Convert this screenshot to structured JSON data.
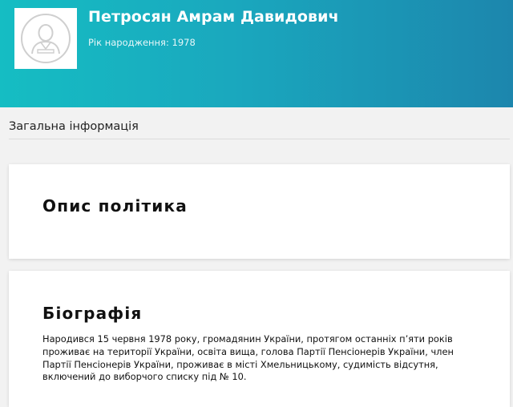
{
  "profile": {
    "name": "Петросян Амрам Давидович",
    "birth_label": "Рік народження:",
    "birth_year": "1978",
    "avatar_icon": "user-avatar-icon"
  },
  "section": {
    "title": "Загальна інформація"
  },
  "policy_card": {
    "title": "Опис політика"
  },
  "bio_card": {
    "title": "Біографія",
    "text": "Народився 15 червня 1978 року, громадянин України, протягом останніх п’яти років проживає на території України, освіта вища, голова Партії Пенсіонерів України, член Партії Пенсіонерів України, проживає в місті Хмельницькому, судимість відсутня, включений до виборчого списку під № 10."
  },
  "colors": {
    "header_gradient_start": "#15bdc3",
    "header_gradient_end": "#1c86ad",
    "page_background": "#f2f2f2"
  }
}
